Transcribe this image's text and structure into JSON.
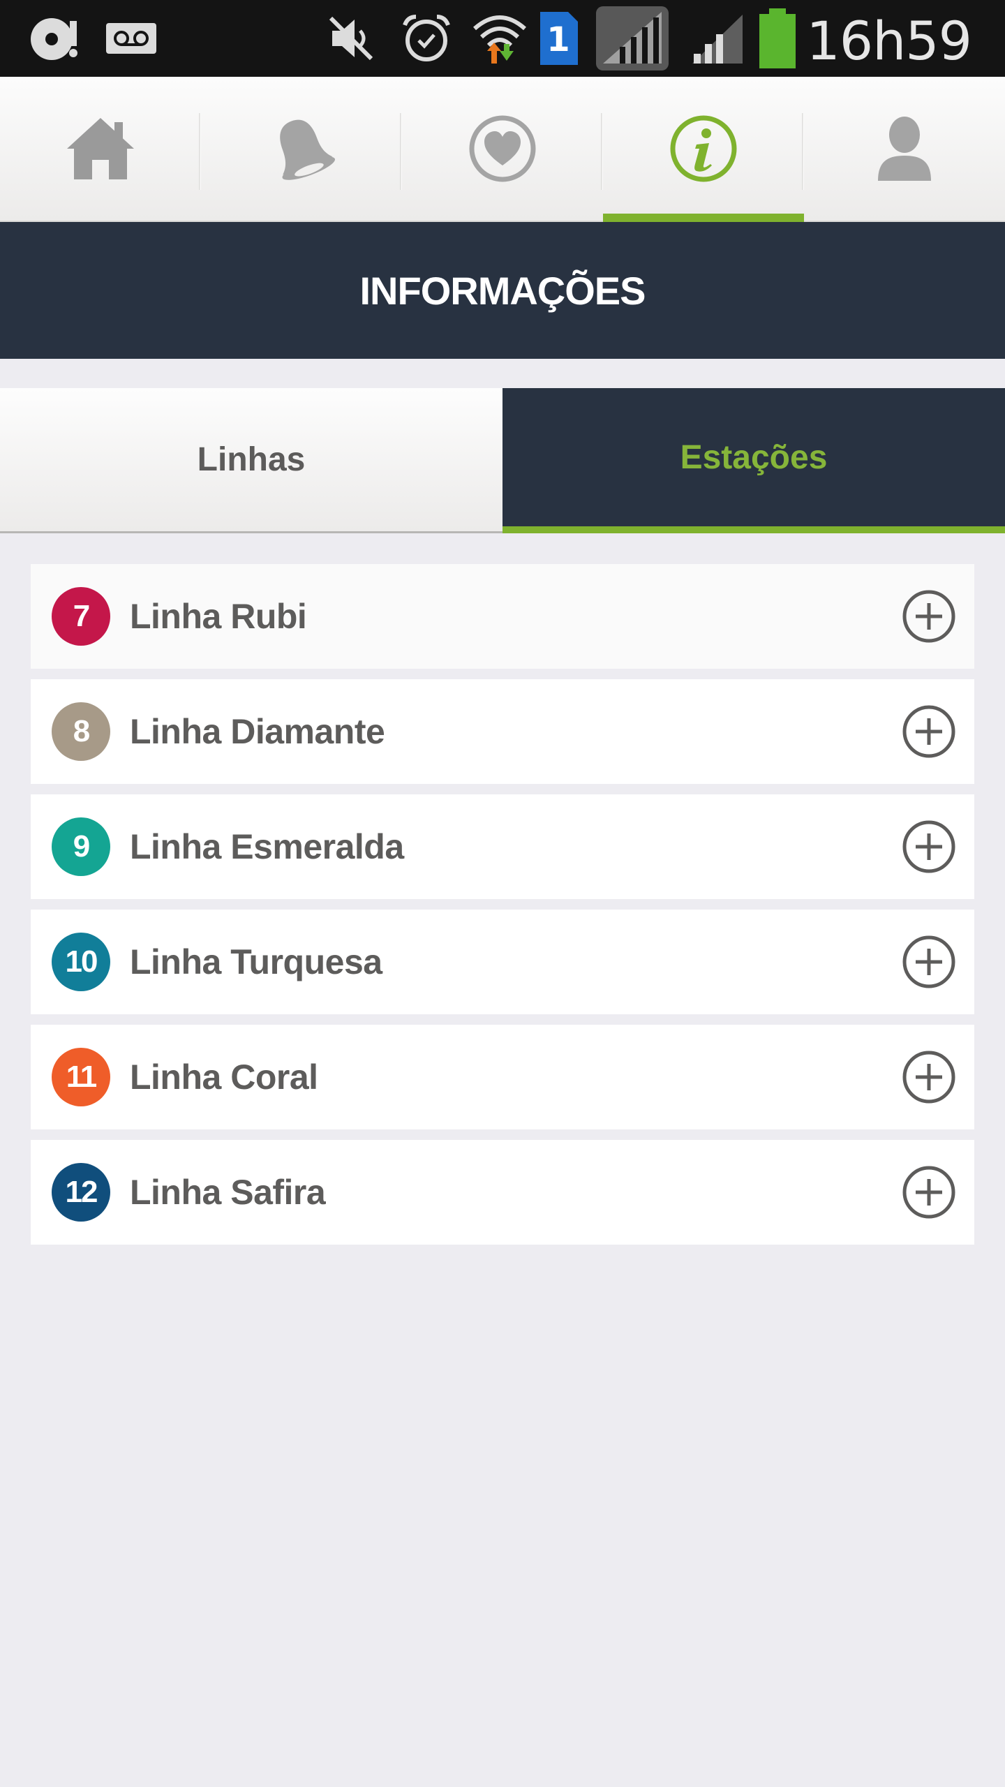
{
  "status_bar": {
    "clock": "16h59",
    "sim_slot": "1",
    "icons": [
      "voicemail-disc-icon",
      "voicemail-tape-icon",
      "mute-icon",
      "alarm-icon",
      "wifi-icon",
      "sim-card-icon",
      "signal-icon",
      "signal-icon",
      "battery-icon"
    ]
  },
  "nav": {
    "tabs": [
      {
        "name": "home",
        "icon": "home-icon"
      },
      {
        "name": "notifications",
        "icon": "bell-icon"
      },
      {
        "name": "favorites",
        "icon": "heart-icon"
      },
      {
        "name": "info",
        "icon": "info-icon",
        "active": true
      },
      {
        "name": "profile",
        "icon": "user-icon"
      }
    ]
  },
  "header": {
    "title": "INFORMAÇÕES"
  },
  "segmented": {
    "linhas": "Linhas",
    "estacoes": "Estações",
    "active": "estacoes"
  },
  "lines": [
    {
      "number": "7",
      "name": "Linha Rubi",
      "color": "#c4174a"
    },
    {
      "number": "8",
      "name": "Linha Diamante",
      "color": "#a79a88"
    },
    {
      "number": "9",
      "name": "Linha Esmeralda",
      "color": "#14a593"
    },
    {
      "number": "10",
      "name": "Linha Turquesa",
      "color": "#117e99"
    },
    {
      "number": "11",
      "name": "Linha Coral",
      "color": "#ef5d29"
    },
    {
      "number": "12",
      "name": "Linha Safira",
      "color": "#104e7c"
    }
  ],
  "colors": {
    "accent": "#7fb22e",
    "header_bg": "#283241",
    "page_bg": "#edecf1"
  }
}
